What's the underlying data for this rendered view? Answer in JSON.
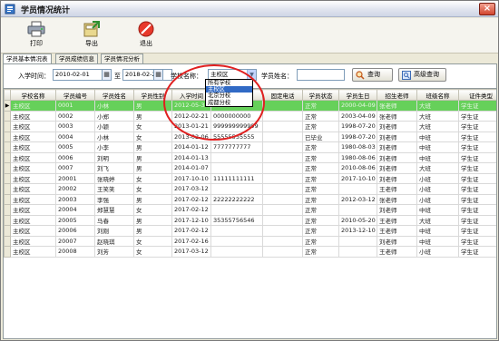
{
  "window": {
    "title": "学员情况统计"
  },
  "toolbar": {
    "print_label": "打印",
    "export_label": "导出",
    "exit_label": "退出"
  },
  "tabs": [
    "学员基本情况表",
    "学员成绩信息",
    "学员情况分析"
  ],
  "filter": {
    "enroll_label": "入学时间：",
    "date_from": "2010-02-01",
    "to_label": "至",
    "date_to": "2018-02-21",
    "school_label": "学校名称：",
    "school_value": "主校区",
    "student_name_label": "学员姓名：",
    "student_name_value": "",
    "query_label": "查询",
    "advanced_query_label": "高级查询",
    "school_options": [
      "所有学校",
      "主校区",
      "北京分校",
      "成都分校"
    ]
  },
  "grid": {
    "columns": [
      "学校名称",
      "学员编号",
      "学员姓名",
      "学员性别",
      "入学时间",
      "联系电话",
      "固定电话",
      "学员状态",
      "学员生日",
      "招生老师",
      "班级名称",
      "证件类型"
    ],
    "rows": [
      [
        "主校区",
        "0001",
        "小林",
        "男",
        "2012-05-30",
        "",
        "",
        "正常",
        "2000-04-09",
        "张老师",
        "大班",
        "学生证"
      ],
      [
        "主校区",
        "0002",
        "小郑",
        "男",
        "2012-02-21",
        "0000000000",
        "",
        "正常",
        "2003-04-09",
        "张老师",
        "大班",
        "学生证"
      ],
      [
        "主校区",
        "0003",
        "小颖",
        "女",
        "2013-01-21",
        "999999999999",
        "",
        "正常",
        "1998-07-20",
        "刘老师",
        "大班",
        "学生证"
      ],
      [
        "主校区",
        "0004",
        "小林",
        "女",
        "2013-02-06",
        "55555555555",
        "",
        "已毕业",
        "1998-07-20",
        "刘老师",
        "中班",
        "学生证"
      ],
      [
        "主校区",
        "0005",
        "小李",
        "男",
        "2014-01-12",
        "7777777777",
        "",
        "正常",
        "1980-08-03",
        "刘老师",
        "中班",
        "学生证"
      ],
      [
        "主校区",
        "0006",
        "刘明",
        "男",
        "2014-01-13",
        "",
        "",
        "正常",
        "1980-08-06",
        "刘老师",
        "中班",
        "学生证"
      ],
      [
        "主校区",
        "0007",
        "刘飞",
        "男",
        "2014-01-07",
        "",
        "",
        "正常",
        "2010-08-06",
        "刘老师",
        "大班",
        "学生证"
      ],
      [
        "主校区",
        "20001",
        "张晓婷",
        "女",
        "2017-10-10",
        "11111111111",
        "",
        "正常",
        "2017-10-10",
        "刘老师",
        "小班",
        "学生证"
      ],
      [
        "主校区",
        "20002",
        "王笑笑",
        "女",
        "2017-03-12",
        "",
        "",
        "正常",
        "",
        "王老师",
        "小班",
        "学生证"
      ],
      [
        "主校区",
        "20003",
        "李强",
        "男",
        "2017-02-12",
        "22222222222",
        "",
        "正常",
        "2012-03-12",
        "张老师",
        "小班",
        "学生证"
      ],
      [
        "主校区",
        "20004",
        "郑慧慧",
        "女",
        "2017-02-12",
        "",
        "",
        "正常",
        "",
        "刘老师",
        "中班",
        "学生证"
      ],
      [
        "主校区",
        "20005",
        "马春",
        "男",
        "2017-12-10",
        "35355756546",
        "",
        "正常",
        "2010-05-20",
        "王老师",
        "大班",
        "学生证"
      ],
      [
        "主校区",
        "20006",
        "刘刚",
        "男",
        "2017-02-12",
        "",
        "",
        "正常",
        "2013-12-10",
        "王老师",
        "中班",
        "学生证"
      ],
      [
        "主校区",
        "20007",
        "赵晓琪",
        "女",
        "2017-02-16",
        "",
        "",
        "正常",
        "",
        "刘老师",
        "中班",
        "学生证"
      ],
      [
        "主校区",
        "20008",
        "刘芳",
        "女",
        "2017-03-12",
        "",
        "",
        "正常",
        "",
        "王老师",
        "小班",
        "学生证"
      ]
    ],
    "selected_indicator": "▶"
  },
  "colors": {
    "selected_row": "#66d05a",
    "annotation_circle": "#e02020",
    "dropdown_highlight": "#316ac5"
  },
  "icons": {
    "title": "app-icon",
    "print": "printer-icon",
    "export": "export-icon",
    "exit": "exit-icon",
    "query": "search-icon",
    "advanced_query": "advanced-search-icon",
    "calendar": "calendar-icon",
    "dropdown": "chevron-down-icon"
  }
}
